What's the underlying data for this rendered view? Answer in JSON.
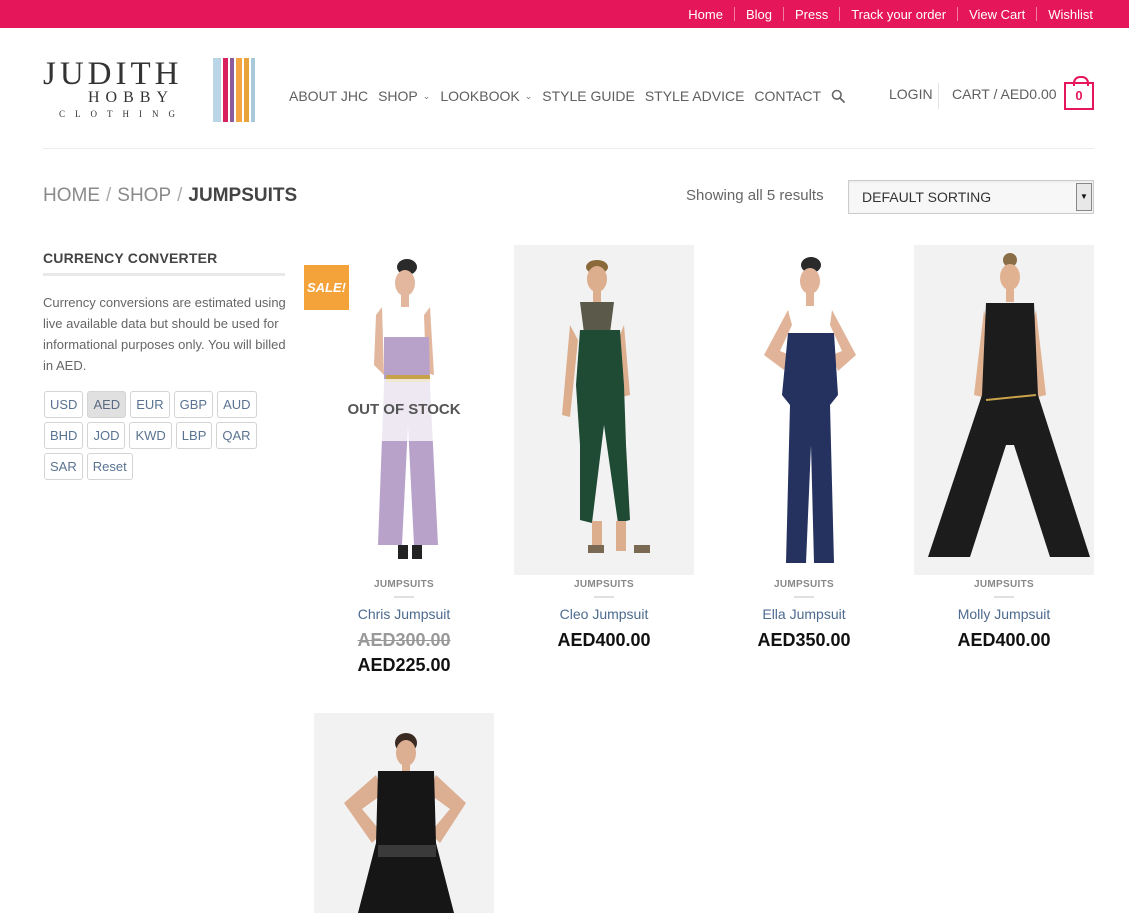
{
  "topbar": {
    "links": [
      "Home",
      "Blog",
      "Press",
      "Track your order",
      "View Cart",
      "Wishlist"
    ]
  },
  "logo": {
    "line1": "JUDITH",
    "line2": "HOBBY",
    "line3": "CLOTHING",
    "stripe_colors": [
      "#b9d5e6",
      "#d8225e",
      "#8c5b9e",
      "#f6a640",
      "#e9a13a",
      "#a9c8da"
    ]
  },
  "nav": {
    "items": [
      {
        "label": "ABOUT JHC",
        "dropdown": false
      },
      {
        "label": "SHOP",
        "dropdown": true
      },
      {
        "label": "LOOKBOOK",
        "dropdown": true
      },
      {
        "label": "STYLE GUIDE",
        "dropdown": false
      },
      {
        "label": "STYLE ADVICE",
        "dropdown": false
      },
      {
        "label": "CONTACT",
        "dropdown": false
      }
    ],
    "login": "LOGIN",
    "cart": "CART / AED0.00",
    "cart_count": "0"
  },
  "breadcrumb": {
    "home": "HOME",
    "shop": "SHOP",
    "current": "JUMPSUITS"
  },
  "results": "Showing all 5 results",
  "sorting": {
    "selected": "DEFAULT SORTING"
  },
  "sidebar": {
    "title": "CURRENCY CONVERTER",
    "text": "Currency conversions are estimated using live available data but should be used for informational purposes only. You will billed in AED.",
    "currencies": [
      "USD",
      "AED",
      "EUR",
      "GBP",
      "AUD",
      "BHD",
      "JOD",
      "KWD",
      "LBP",
      "QAR",
      "SAR",
      "Reset"
    ],
    "active": "AED"
  },
  "products": [
    {
      "category": "JUMPSUITS",
      "name": "Chris Jumpsuit",
      "old_price": "AED300.00",
      "price": "AED225.00",
      "badge": "SALE!",
      "overlay": "OUT OF STOCK",
      "garment_color": "#b9a2c9"
    },
    {
      "category": "JUMPSUITS",
      "name": "Cleo Jumpsuit",
      "price": "AED400.00",
      "garment_color": "#1f4a34"
    },
    {
      "category": "JUMPSUITS",
      "name": "Ella Jumpsuit",
      "price": "AED350.00",
      "garment_color": "#25315f"
    },
    {
      "category": "JUMPSUITS",
      "name": "Molly Jumpsuit",
      "price": "AED400.00",
      "garment_color": "#1c1c1c"
    },
    {
      "category": "",
      "name": "",
      "price": "",
      "garment_color": "#161616"
    }
  ],
  "colors": {
    "accent": "#e5175a",
    "sale_badge": "#f4a23a",
    "link": "#4d6b8f"
  }
}
